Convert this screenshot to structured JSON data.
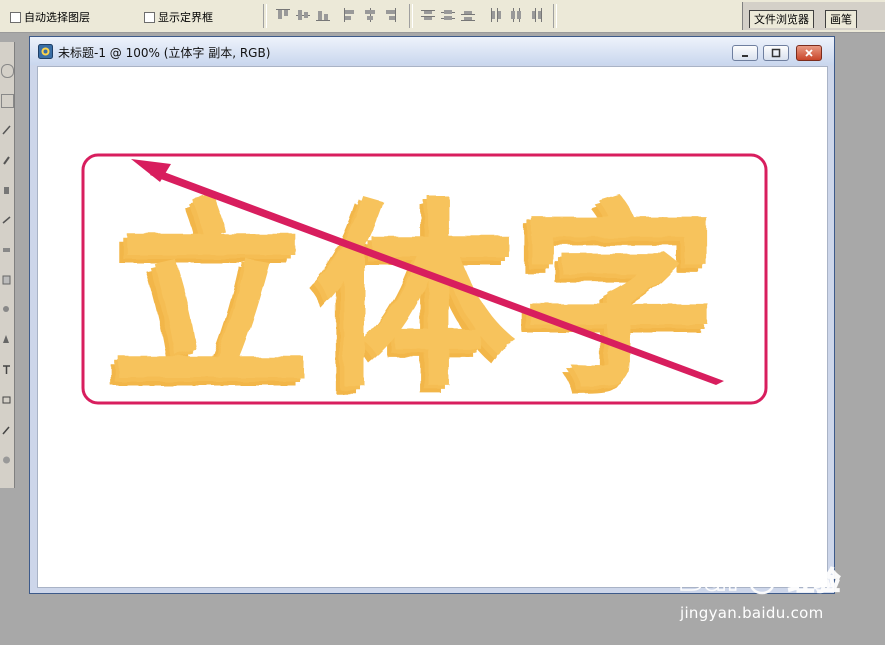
{
  "options_bar": {
    "auto_select_label": "自动选择图层",
    "show_bounds_label": "显示定界框"
  },
  "palette_well": {
    "tabs": [
      "文件浏览器",
      "画笔"
    ]
  },
  "document": {
    "title": "未标题-1 @ 100% (立体字 副本, RGB)"
  },
  "canvas_content": {
    "text": "立体字",
    "text_color": "#f7c35c",
    "frame_color": "#d81e5e",
    "arrow_color": "#d81e5e"
  },
  "watermark": {
    "brand": "Bai",
    "brand_suffix": "经验",
    "url": "jingyan.baidu.com"
  }
}
